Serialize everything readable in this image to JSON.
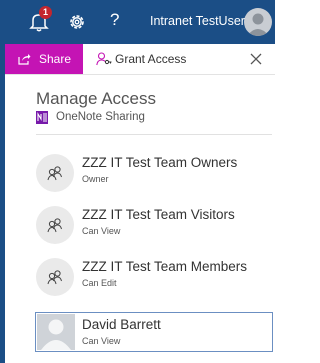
{
  "header": {
    "notification_count": "1",
    "help_label": "?",
    "user_name": "Intranet TestUser",
    "bg_color": "#1b4e86"
  },
  "tabs": {
    "share_label": "Share",
    "grant_label": "Grant Access",
    "share_color": "#c414b4"
  },
  "panel": {
    "title": "Manage Access",
    "subtitle": "OneNote Sharing"
  },
  "groups": [
    {
      "name": "ZZZ IT Test Team Owners",
      "permission": "Owner"
    },
    {
      "name": "ZZZ IT Test Team Visitors",
      "permission": "Can View"
    },
    {
      "name": "ZZZ IT Test Team Members",
      "permission": "Can Edit"
    }
  ],
  "users": [
    {
      "name": "David Barrett",
      "permission": "Can View"
    }
  ],
  "icons": {
    "notifications": "bell-icon",
    "settings": "gear-icon",
    "share": "share-icon",
    "grant": "person-key-icon",
    "close": "close-icon",
    "onenote": "onenote-icon",
    "group": "people-icon"
  }
}
